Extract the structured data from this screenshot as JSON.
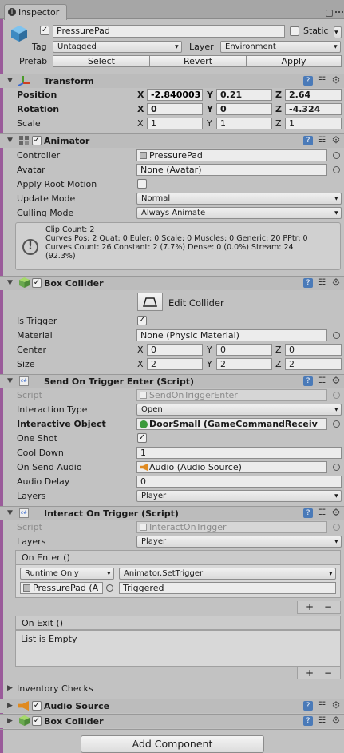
{
  "tab": {
    "title": "Inspector"
  },
  "object": {
    "name": "PressurePad",
    "static_label": "Static",
    "tag_label": "Tag",
    "tag_value": "Untagged",
    "layer_label": "Layer",
    "layer_value": "Environment",
    "prefab_label": "Prefab",
    "select_label": "Select",
    "revert_label": "Revert",
    "apply_label": "Apply"
  },
  "transform": {
    "title": "Transform",
    "position_label": "Position",
    "rotation_label": "Rotation",
    "scale_label": "Scale",
    "position": {
      "x": "-2.840003",
      "y": "0.21",
      "z": "2.64"
    },
    "rotation": {
      "x": "0",
      "y": "0",
      "z": "-4.324"
    },
    "scale": {
      "x": "1",
      "y": "1",
      "z": "1"
    },
    "axis": {
      "x": "X",
      "y": "Y",
      "z": "Z"
    }
  },
  "animator": {
    "title": "Animator",
    "controller_label": "Controller",
    "controller_value": "PressurePad",
    "avatar_label": "Avatar",
    "avatar_value": "None (Avatar)",
    "root_motion_label": "Apply Root Motion",
    "update_label": "Update Mode",
    "update_value": "Normal",
    "culling_label": "Culling Mode",
    "culling_value": "Always Animate",
    "info": [
      "Clip Count: 2",
      "Curves Pos: 2 Quat: 0 Euler: 0 Scale: 0 Muscles: 0 Generic: 20 PPtr: 0",
      "Curves Count: 26 Constant: 2 (7.7%) Dense: 0 (0.0%) Stream: 24",
      "(92.3%)"
    ]
  },
  "box_collider": {
    "title": "Box Collider",
    "edit_label": "Edit Collider",
    "trigger_label": "Is Trigger",
    "material_label": "Material",
    "material_value": "None (Physic Material)",
    "center_label": "Center",
    "size_label": "Size",
    "center": {
      "x": "0",
      "y": "0",
      "z": "0"
    },
    "size": {
      "x": "2",
      "y": "2",
      "z": "2"
    }
  },
  "send_trigger": {
    "title": "Send On Trigger Enter (Script)",
    "script_label": "Script",
    "script_value": "SendOnTriggerEnter",
    "interaction_label": "Interaction Type",
    "interaction_value": "Open",
    "object_label": "Interactive Object",
    "object_value": "DoorSmall (GameCommandReceiv",
    "oneshot_label": "One Shot",
    "cooldown_label": "Cool Down",
    "cooldown_value": "1",
    "audio_label": "On Send Audio",
    "audio_value": "Audio (Audio Source)",
    "delay_label": "Audio Delay",
    "delay_value": "0",
    "layers_label": "Layers",
    "layers_value": "Player"
  },
  "interact_trigger": {
    "title": "Interact On Trigger (Script)",
    "script_label": "Script",
    "script_value": "InteractOnTrigger",
    "layers_label": "Layers",
    "layers_value": "Player",
    "on_enter_label": "On Enter ()",
    "runtime_value": "Runtime Only",
    "function_value": "Animator.SetTrigger",
    "target_value": "PressurePad (A",
    "param_value": "Triggered",
    "plus": "+",
    "minus": "−",
    "on_exit_label": "On Exit ()",
    "empty_label": "List is Empty",
    "inventory_label": "Inventory Checks"
  },
  "audio_source": {
    "title": "Audio Source"
  },
  "box_collider2": {
    "title": "Box Collider"
  },
  "add_component": {
    "label": "Add Component"
  }
}
